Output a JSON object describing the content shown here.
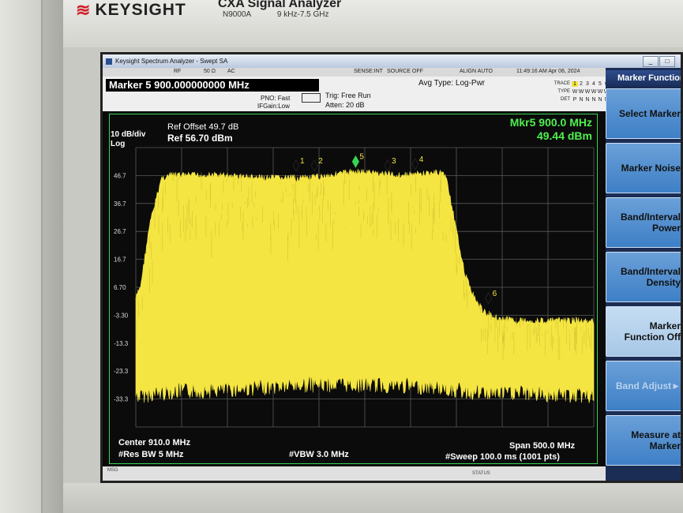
{
  "instrument": {
    "logo_mark": "≋",
    "brand": "KEYSIGHT",
    "model_title": "CXA Signal Analyzer",
    "model_number": "N9000A",
    "freq_range": "9 kHz-7.5 GHz"
  },
  "window": {
    "title": "Keysight Spectrum Analyzer - Swept SA"
  },
  "status_row": {
    "rf": "RF",
    "impedance": "50 Ω",
    "coupling": "AC",
    "sense": "SENSE:INT",
    "source": "SOURCE OFF",
    "align": "ALIGN AUTO",
    "datetime": "11:49:16 AM Apr 06, 2024"
  },
  "info": {
    "marker_line": "Marker 5  900.000000000 MHz",
    "pno": "PNO: Fast",
    "ifgain": "IFGain:Low",
    "trig": "Trig: Free Run",
    "atten": "Atten: 20 dB",
    "avg_type": "Avg Type: Log-Pwr",
    "trace_label": "TRACE",
    "type_label": "TYPE",
    "det_label": "DET",
    "trace_cells": [
      "1",
      "2",
      "3",
      "4",
      "5",
      "6"
    ],
    "type_cells": [
      "W",
      "W",
      "W",
      "W",
      "W",
      "W"
    ],
    "det_cells": [
      "P",
      "N",
      "N",
      "N",
      "N",
      "N"
    ]
  },
  "display": {
    "scale": "10 dB/div",
    "scale_type": "Log",
    "ref_offset": "Ref Offset 49.7 dB",
    "ref_level": "Ref 56.70 dBm",
    "marker_readout_freq": "Mkr5 900.0 MHz",
    "marker_readout_amp": "49.44 dBm",
    "center": "Center 910.0 MHz",
    "res_bw": "#Res BW 5 MHz",
    "vbw": "#VBW 3.0 MHz",
    "span": "Span 500.0 MHz",
    "sweep": "#Sweep  100.0 ms (1001 pts)",
    "msg_label": "MSG",
    "status_label": "STATUS"
  },
  "chart_data": {
    "type": "area",
    "xlabel": "",
    "ylabel": "",
    "xlim": [
      660,
      1160
    ],
    "ylim": [
      -43.3,
      56.7
    ],
    "y_ticks": [
      46.7,
      36.7,
      26.7,
      16.7,
      6.7,
      -3.3,
      -13.3,
      -23.3,
      -33.3
    ],
    "y_tick_labels": [
      "46.7",
      "36.7",
      "26.7",
      "16.7",
      "6.70",
      "-3.30",
      "-13.3",
      "-23.3",
      "-33.3"
    ],
    "grid": true,
    "trace_color": "#f4e542",
    "trace_envelope": {
      "x_mhz": [
        660,
        665,
        675,
        688,
        700,
        750,
        800,
        850,
        900,
        950,
        995,
        1000,
        1010,
        1020,
        1030,
        1040,
        1060,
        1080,
        1110,
        1140,
        1160
      ],
      "peak_dbm": [
        4,
        8,
        30,
        47,
        48,
        48,
        47,
        47,
        49.4,
        48,
        49,
        46,
        28,
        12,
        4,
        -1,
        -3.5,
        -4,
        -4.2,
        -4,
        -4.5
      ],
      "floor_dbm": [
        -29,
        -29,
        -28.5,
        -28,
        -27.5,
        -27,
        -26,
        -25,
        -25,
        -25.5,
        -26,
        -26.5,
        -27,
        -27.5,
        -28,
        -28,
        -28,
        -28,
        -28.5,
        -29,
        -29
      ]
    },
    "markers": [
      {
        "label": "1",
        "x_mhz": 835,
        "y_dbm": 48.0
      },
      {
        "label": "2",
        "x_mhz": 855,
        "y_dbm": 48.0
      },
      {
        "label": "5",
        "x_mhz": 900,
        "y_dbm": 49.44,
        "active": true
      },
      {
        "label": "3",
        "x_mhz": 935,
        "y_dbm": 48.0
      },
      {
        "label": "4",
        "x_mhz": 965,
        "y_dbm": 48.5
      },
      {
        "label": "6",
        "x_mhz": 1045,
        "y_dbm": 0.5
      }
    ]
  },
  "softkeys": {
    "menu_title": "Marker Function",
    "items": [
      {
        "line1": "Select Marker",
        "line2": "",
        "state": "normal"
      },
      {
        "line1": "Marker Noise",
        "line2": "",
        "state": "normal"
      },
      {
        "line1": "Band/Interval",
        "line2": "Power",
        "state": "normal"
      },
      {
        "line1": "Band/Interval",
        "line2": "Density",
        "state": "normal"
      },
      {
        "line1": "Marker",
        "line2": "Function Off",
        "state": "active"
      },
      {
        "line1": "Band Adjust►",
        "line2": "",
        "state": "disabled"
      },
      {
        "line1": "Measure at",
        "line2": "Marker",
        "state": "normal"
      }
    ]
  }
}
